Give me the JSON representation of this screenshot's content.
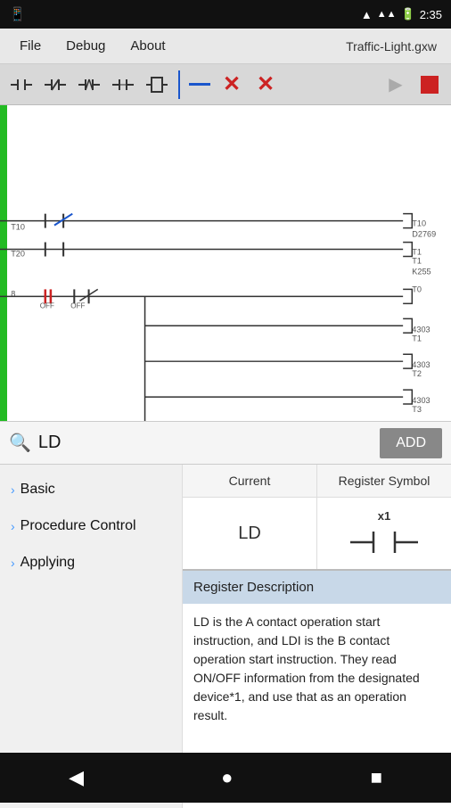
{
  "status_bar": {
    "time": "2:35",
    "icons": [
      "sim",
      "wifi",
      "battery"
    ]
  },
  "menu": {
    "file": "File",
    "debug": "Debug",
    "about": "About",
    "title": "Traffic-Light.gxw"
  },
  "search": {
    "value": "LD",
    "placeholder": "Search",
    "add_label": "ADD"
  },
  "sidebar": {
    "items": [
      {
        "label": "Basic"
      },
      {
        "label": "Procedure Control"
      },
      {
        "label": "Applying"
      }
    ]
  },
  "panel": {
    "header": {
      "col1": "Current",
      "col2": "Register Symbol"
    },
    "body": {
      "current": "LD",
      "symbol_x1": "x1"
    },
    "register_description_label": "Register Description",
    "description": "LD is the A contact operation start instruction, and LDI is the B contact operation start instruction. They read ON/OFF information from the designated device*1, and use that as an operation result."
  },
  "colors": {
    "green_bar": "#22bb22",
    "accent_blue": "#1a56cc",
    "accent_red": "#cc2222",
    "add_btn_bg": "#888888",
    "reg_desc_header_bg": "#c8d8e8"
  }
}
